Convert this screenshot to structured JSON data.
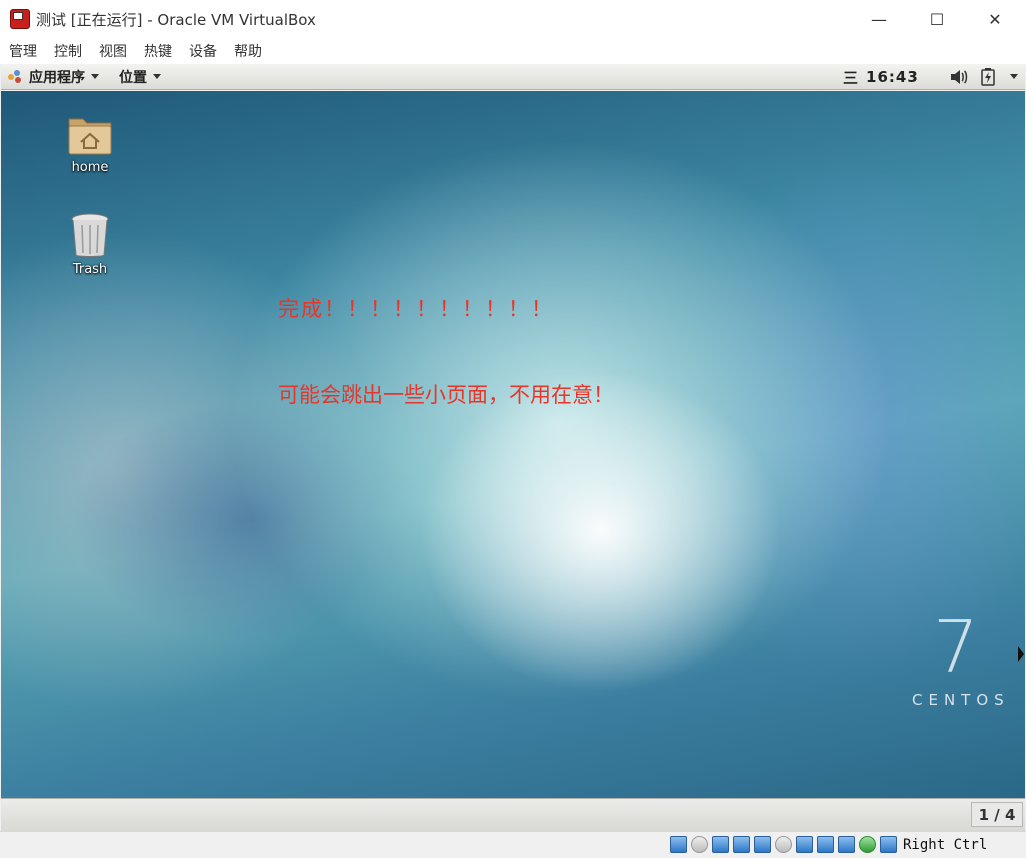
{
  "window": {
    "title": "测试 [正在运行] - Oracle VM VirtualBox",
    "controls": {
      "minimize": "—",
      "maximize": "☐",
      "close": "✕"
    }
  },
  "menubar": [
    "管理",
    "控制",
    "视图",
    "热键",
    "设备",
    "帮助"
  ],
  "gnome_panel": {
    "applications": "应用程序",
    "places": "位置",
    "clock_menu_glyph": "三",
    "clock": "16:43"
  },
  "desktop": {
    "icons": [
      {
        "label": "home",
        "icon": "home-folder-icon"
      },
      {
        "label": "Trash",
        "icon": "trash-icon"
      }
    ],
    "notes": [
      "完成！！！！！！！！！！",
      "可能会跳出一些小页面，不用在意！"
    ],
    "watermark": {
      "number": "7",
      "word": "CENTOS"
    }
  },
  "bottom_panel": {
    "workspace": "1 / 4"
  },
  "statusbar": {
    "icons": [
      "hard-disk-icon",
      "optical-drive-icon",
      "audio-icon",
      "network-icon",
      "usb-icon",
      "shared-folders-icon",
      "display-icon",
      "video-capture-icon",
      "virtualization-icon",
      "mouse-integration-icon",
      "keyboard-capture-icon"
    ],
    "host_key": "Right Ctrl"
  },
  "colors": {
    "note_text": "#e8352a",
    "app_icon": "#c8201c"
  }
}
